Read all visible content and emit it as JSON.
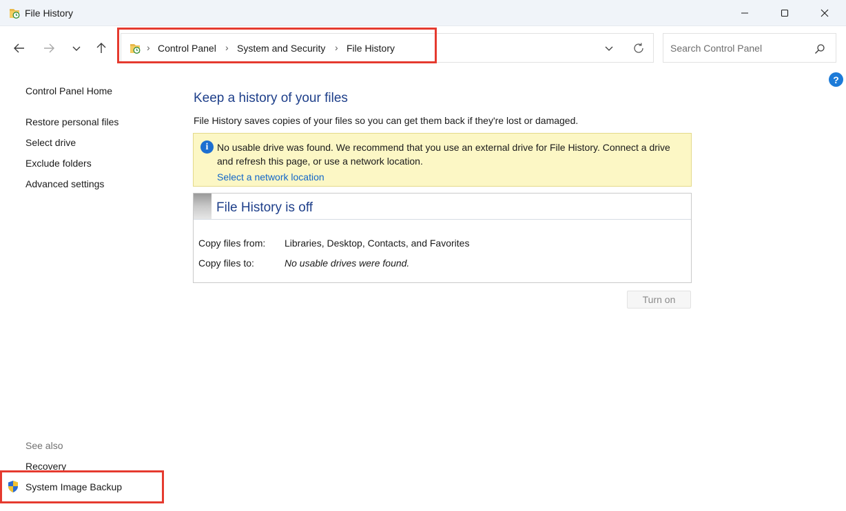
{
  "window": {
    "title": "File History",
    "icon": "file-history-icon"
  },
  "nav": {
    "back_icon": "arrow-left-icon",
    "forward_icon": "arrow-right-icon",
    "recent_icon": "chevron-down-icon",
    "up_icon": "arrow-up-icon"
  },
  "address": {
    "breadcrumbs": [
      "Control Panel",
      "System and Security",
      "File History"
    ],
    "separator": "›"
  },
  "search": {
    "placeholder": "Search Control Panel"
  },
  "help": {
    "label": "?"
  },
  "sidebar": {
    "home": "Control Panel Home",
    "links": [
      "Restore personal files",
      "Select drive",
      "Exclude folders",
      "Advanced settings"
    ],
    "see_also_label": "See also",
    "see_also": [
      "Recovery",
      "System Image Backup"
    ]
  },
  "main": {
    "heading": "Keep a history of your files",
    "description": "File History saves copies of your files so you can get them back if they're lost or damaged.",
    "info": {
      "message": "No usable drive was found. We recommend that you use an external drive for File History. Connect a drive and refresh this page, or use a network location.",
      "link": "Select a network location"
    },
    "status": {
      "title": "File History is off",
      "copy_from_label": "Copy files from:",
      "copy_from_value": "Libraries, Desktop, Contacts, and Favorites",
      "copy_to_label": "Copy files to:",
      "copy_to_value": "No usable drives were found."
    },
    "turn_on_label": "Turn on"
  },
  "colors": {
    "heading": "#1e3f8a",
    "link": "#1166c9",
    "info_bg": "#fcf7c5",
    "highlight": "#e53a2f"
  }
}
